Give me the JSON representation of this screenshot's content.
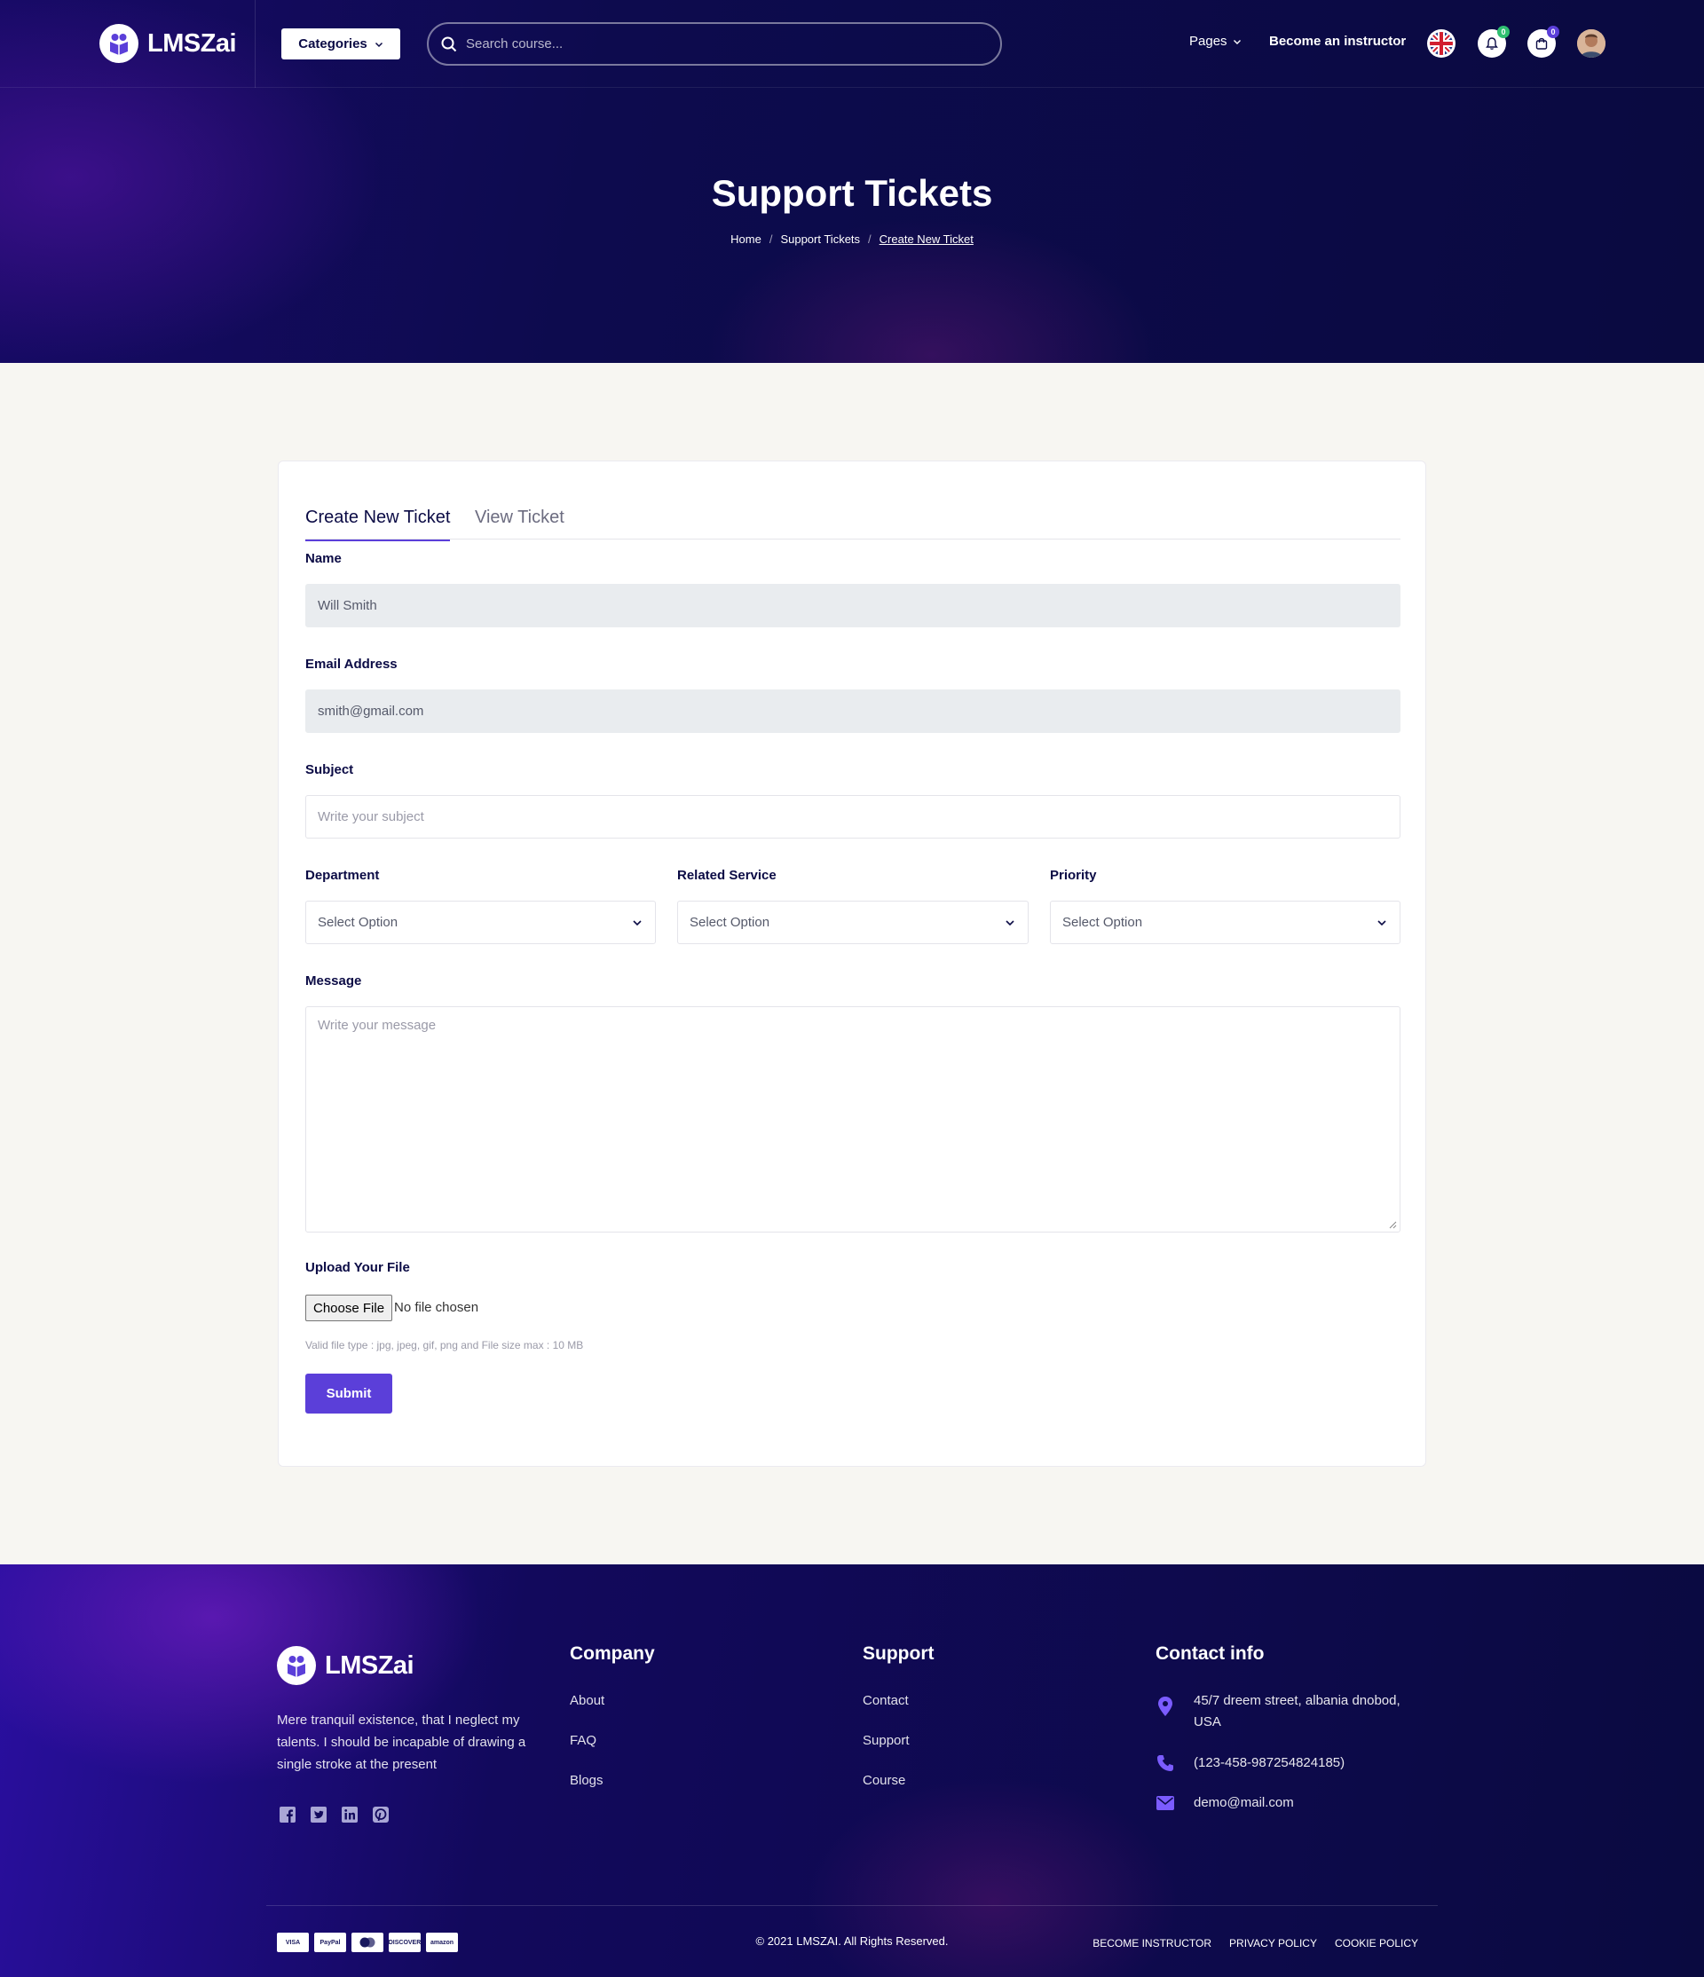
{
  "brand": {
    "name": "LMSZai"
  },
  "header": {
    "categories_label": "Categories",
    "search_placeholder": "Search course...",
    "pages_label": "Pages",
    "instructor_label": "Become an instructor",
    "notification_count": "0",
    "cart_count": "0",
    "colors": {
      "notification_badge": "#2fbf71",
      "cart_badge": "#5b3fd9"
    }
  },
  "hero": {
    "title": "Support Tickets",
    "breadcrumb": [
      "Home",
      "Support Tickets",
      "Create New Ticket"
    ],
    "separator": "/"
  },
  "form": {
    "tabs": [
      "Create New Ticket",
      "View Ticket"
    ],
    "name_label": "Name",
    "name_value": "Will Smith",
    "email_label": "Email Address",
    "email_value": "smith@gmail.com",
    "subject_label": "Subject",
    "subject_placeholder": "Write your subject",
    "department_label": "Department",
    "department_value": "Select Option",
    "service_label": "Related Service",
    "service_value": "Select Option",
    "priority_label": "Priority",
    "priority_value": "Select Option",
    "message_label": "Message",
    "message_placeholder": "Write your message",
    "upload_label": "Upload Your File",
    "choose_file_label": "Choose File",
    "no_file_label": "No file chosen",
    "file_hint": "Valid file type : jpg, jpeg, gif, png and File size max : 10 MB",
    "submit_label": "Submit",
    "accent_color": "#5b3fd9"
  },
  "footer": {
    "description": "Mere tranquil existence, that I neglect my talents. I should be incapable of drawing a single stroke at the present",
    "socials": [
      "facebook-icon",
      "twitter-icon",
      "linkedin-icon",
      "pinterest-icon"
    ],
    "company_title": "Company",
    "company_links": [
      "About",
      "FAQ",
      "Blogs"
    ],
    "support_title": "Support",
    "support_links": [
      "Contact",
      "Support",
      "Course"
    ],
    "contact_title": "Contact info",
    "address": "45/7 dreem street, albania dnobod, USA",
    "phone": "(123-458-987254824185)",
    "email": "demo@mail.com",
    "payments": [
      "VISA",
      "PayPal",
      "MC",
      "DISCOVER",
      "amazon"
    ],
    "copyright": "© 2021 LMSZAI. All Rights Reserved.",
    "bottom_links": [
      "BECOME INSTRUCTOR",
      "PRIVACY POLICY",
      "COOKIE POLICY"
    ]
  }
}
